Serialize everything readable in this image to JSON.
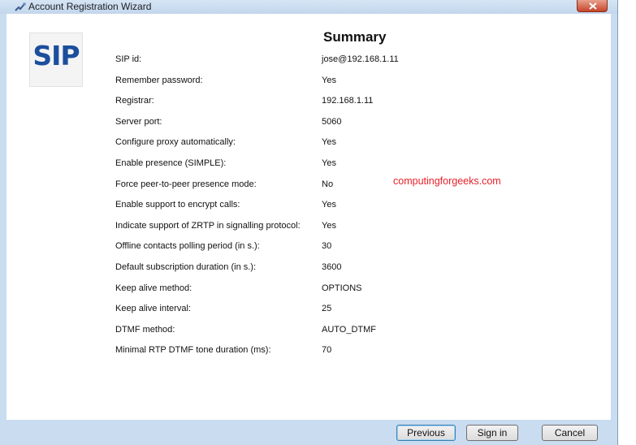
{
  "window": {
    "title": "Account Registration Wizard"
  },
  "logo": {
    "text": "SIP"
  },
  "summary": {
    "title": "Summary",
    "rows": [
      {
        "label": "SIP id:",
        "value": "jose@192.168.1.11"
      },
      {
        "label": "Remember password:",
        "value": "Yes"
      },
      {
        "label": "Registrar:",
        "value": "192.168.1.11"
      },
      {
        "label": "Server port:",
        "value": "5060"
      },
      {
        "label": "Configure proxy automatically:",
        "value": "Yes"
      },
      {
        "label": "Enable presence (SIMPLE):",
        "value": "Yes"
      },
      {
        "label": "Force peer-to-peer presence mode:",
        "value": "No"
      },
      {
        "label": "Enable support to encrypt calls:",
        "value": "Yes"
      },
      {
        "label": "Indicate support of ZRTP in signalling protocol:",
        "value": "Yes"
      },
      {
        "label": "Offline contacts polling period (in s.):",
        "value": "30"
      },
      {
        "label": "Default subscription duration (in s.):",
        "value": "3600"
      },
      {
        "label": "Keep alive method:",
        "value": "OPTIONS"
      },
      {
        "label": "Keep alive interval:",
        "value": "25"
      },
      {
        "label": "DTMF method:",
        "value": "AUTO_DTMF"
      },
      {
        "label": "Minimal RTP DTMF tone duration (ms):",
        "value": "70"
      }
    ]
  },
  "watermark": {
    "text": "computingforgeeks.com"
  },
  "buttons": {
    "previous": "Previous",
    "signin": "Sign in",
    "cancel": "Cancel"
  }
}
